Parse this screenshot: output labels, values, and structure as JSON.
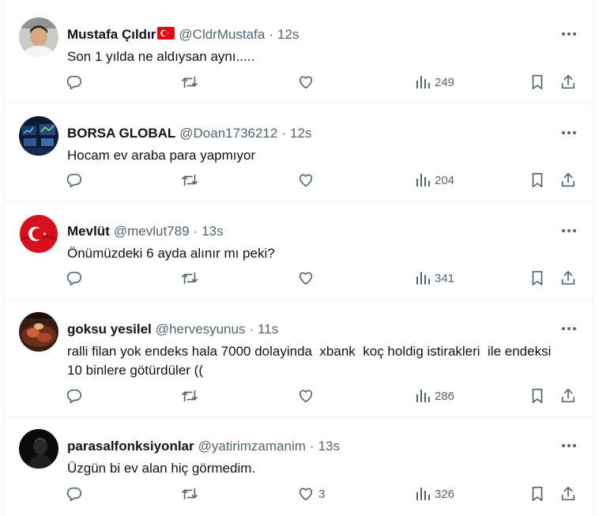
{
  "colors": {
    "text": "#0f1419",
    "muted": "#536471",
    "border": "#eff3f4"
  },
  "tweets": [
    {
      "name": "Mustafa Çıldır",
      "flag": "turkey-flag-emoji",
      "handle": "@CldrMustafa",
      "time": "12s",
      "text": "Son 1 yılda ne aldıysan aynı.....",
      "likes": "",
      "views": "249"
    },
    {
      "name": "BORSA GLOBAL",
      "handle": "@Doan1736212",
      "time": "12s",
      "text": "Hocam ev araba para yapmıyor",
      "likes": "",
      "views": "204"
    },
    {
      "name": "Mevlüt",
      "handle": "@mevlut789",
      "time": "13s",
      "text": "Önümüzdeki 6 ayda alınır mı peki?",
      "likes": "",
      "views": "341"
    },
    {
      "name": "goksu yesilel",
      "handle": "@hervesyunus",
      "time": "11s",
      "text": "ralli filan yok endeks hala 7000 dolayinda  xbank  koç holdig istirakleri  ile endeksi  10 binlere götürdüler ((",
      "likes": "",
      "views": "286"
    },
    {
      "name": "parasalfonksiyonlar",
      "handle": "@yatirimzamanim",
      "time": "13s",
      "text": "Üzgün bi ev alan hiç görmedim.",
      "likes": "3",
      "views": "326"
    }
  ],
  "separator": "·"
}
